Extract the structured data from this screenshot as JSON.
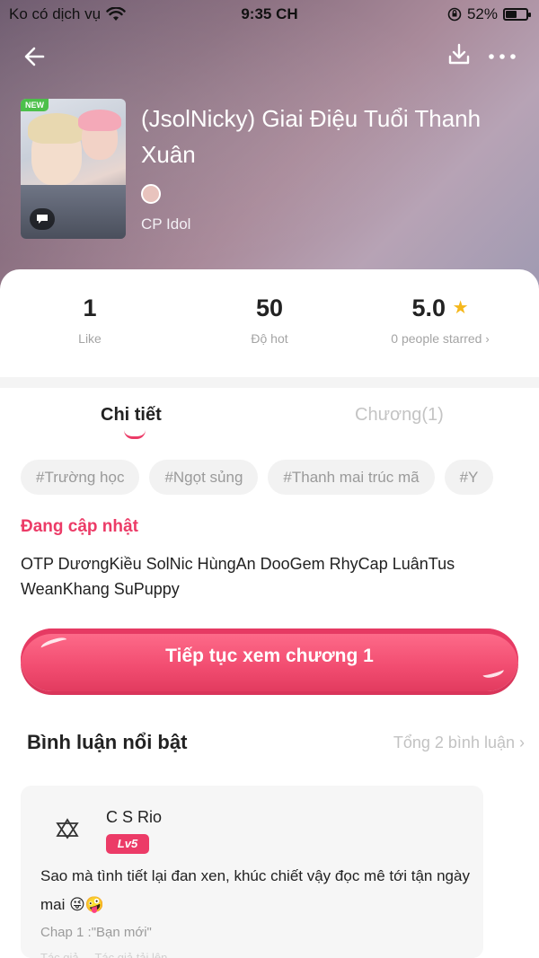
{
  "status_bar": {
    "carrier": "Ko có dịch vụ",
    "time": "9:35 CH",
    "battery": "52%",
    "battery_level": 0.52
  },
  "header": {
    "back_icon": "back-arrow-icon",
    "download_icon": "download-icon",
    "more_icon": "more-horizontal-icon"
  },
  "story": {
    "new_badge": "NEW",
    "title": "(JsolNicky) Giai Điệu Tuổi Thanh Xuân",
    "category": "CP Idol"
  },
  "stats": {
    "likes": "1",
    "likes_label": "Like",
    "hot": "50",
    "hot_label": "Độ hot",
    "rating": "5.0",
    "rating_label": "0 people starred",
    "star_color": "#f5b71b"
  },
  "tabs": [
    {
      "label": "Chi tiết",
      "active": true
    },
    {
      "label": "Chương(1)",
      "active": false
    }
  ],
  "tags": [
    "#Trường học",
    "#Ngọt sủng",
    "#Thanh mai trúc mã",
    "#Y"
  ],
  "status_update": "Đang cập nhật",
  "description": "OTP DươngKiều SolNic HùngAn DooGem RhyCap LuânTus WeanKhang SuPuppy",
  "cta": {
    "label": "Tiếp tục xem chương 1",
    "color": "#f24d71"
  },
  "comments": {
    "title": "Bình luận nổi bật",
    "total": "Tổng 2 bình luận",
    "first": {
      "user": "C S Rio",
      "level": "Lv5",
      "text": "Sao mà tình tiết lại đan xen, khúc chiết vậy đọc mê tới tận ngày mai 😜🤪",
      "chapter": "Chap 1 :\"Bạn mới\"",
      "faded": "Tác giả ... Tác giả tải lên"
    }
  },
  "accent_color": "#ec3b67"
}
